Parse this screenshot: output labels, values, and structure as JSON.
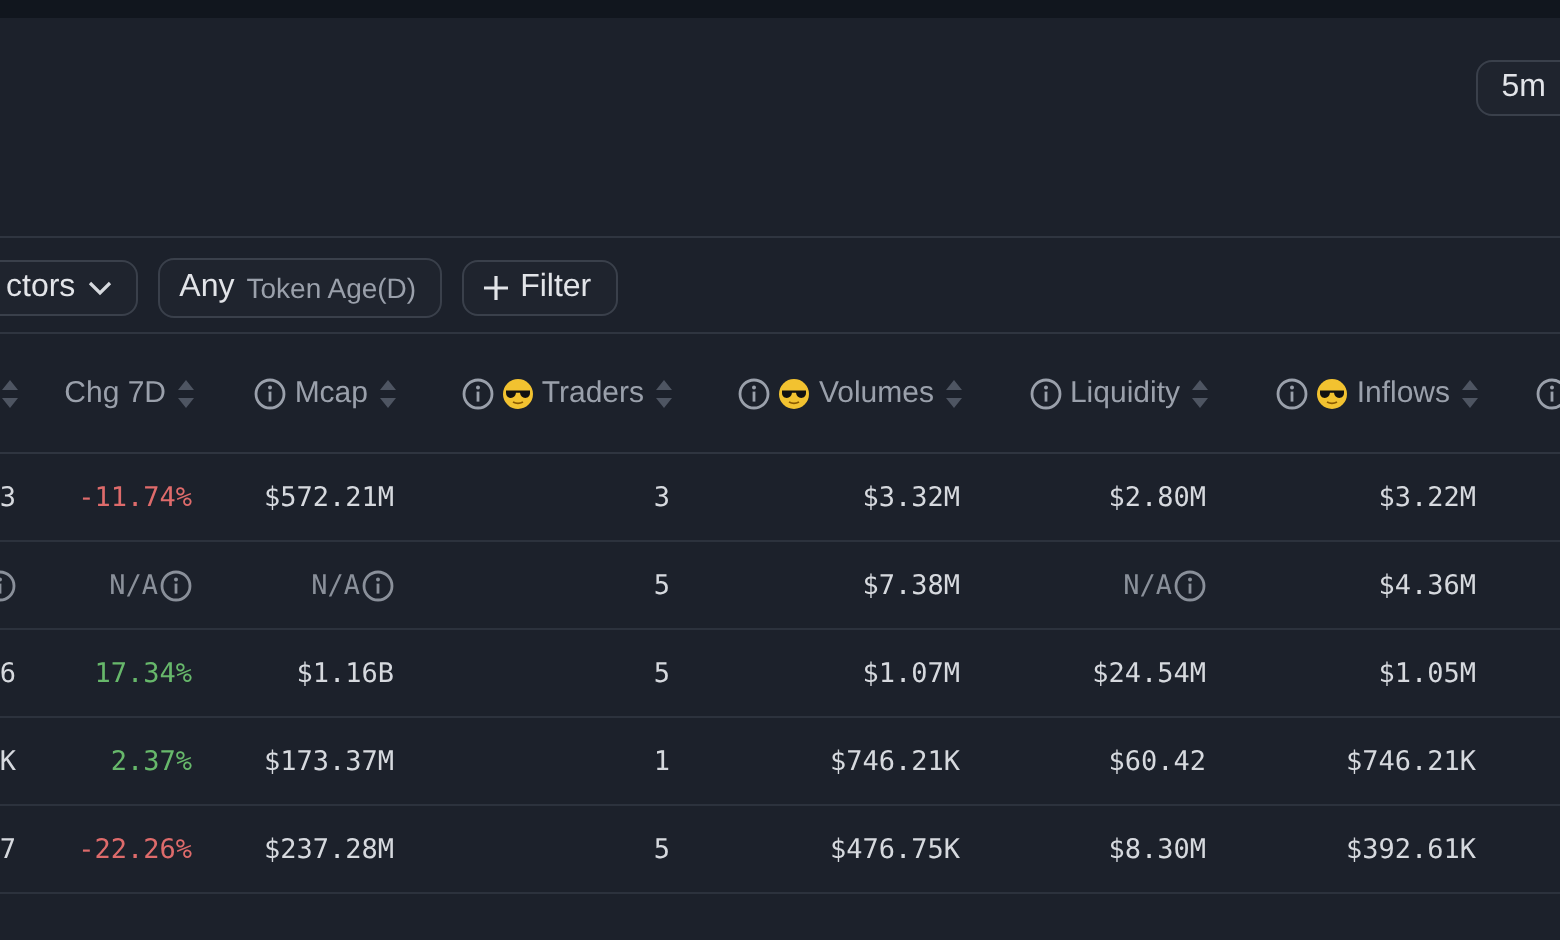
{
  "timeframe": {
    "label": "5m"
  },
  "filters": [
    {
      "kind": "dropdown",
      "label": "ctors"
    },
    {
      "kind": "range",
      "prefix": "Any",
      "label": "Token Age(D)"
    },
    {
      "kind": "add",
      "label": "Filter"
    }
  ],
  "table": {
    "columns": [
      {
        "sortable": true,
        "info": false,
        "emoji": false
      },
      {
        "label": "Chg 7D",
        "sortable": true,
        "info": false,
        "emoji": false
      },
      {
        "label": "Mcap",
        "sortable": true,
        "info": true,
        "emoji": false
      },
      {
        "label": "Traders",
        "sortable": true,
        "info": true,
        "emoji": true
      },
      {
        "label": "Volumes",
        "sortable": true,
        "info": true,
        "emoji": true
      },
      {
        "label": "Liquidity",
        "sortable": true,
        "info": true,
        "emoji": false
      },
      {
        "label": "Inflows",
        "sortable": true,
        "info": true,
        "emoji": true
      },
      {
        "sortable": false,
        "info": true,
        "emoji": false
      }
    ],
    "rows": [
      [
        {
          "kind": "plain",
          "text": "3"
        },
        {
          "kind": "down",
          "text": "-11.74%"
        },
        {
          "kind": "plain",
          "text": "$572.21M"
        },
        {
          "kind": "plain",
          "text": "3"
        },
        {
          "kind": "plain",
          "text": "$3.32M"
        },
        {
          "kind": "plain",
          "text": "$2.80M"
        },
        {
          "kind": "plain",
          "text": "$3.22M"
        }
      ],
      [
        {
          "kind": "na"
        },
        {
          "kind": "na",
          "text": "N/A"
        },
        {
          "kind": "na",
          "text": "N/A"
        },
        {
          "kind": "plain",
          "text": "5"
        },
        {
          "kind": "plain",
          "text": "$7.38M"
        },
        {
          "kind": "na",
          "text": "N/A"
        },
        {
          "kind": "plain",
          "text": "$4.36M"
        }
      ],
      [
        {
          "kind": "plain",
          "text": "6"
        },
        {
          "kind": "up",
          "text": "17.34%"
        },
        {
          "kind": "plain",
          "text": "$1.16B"
        },
        {
          "kind": "plain",
          "text": "5"
        },
        {
          "kind": "plain",
          "text": "$1.07M"
        },
        {
          "kind": "plain",
          "text": "$24.54M"
        },
        {
          "kind": "plain",
          "text": "$1.05M"
        }
      ],
      [
        {
          "kind": "plain",
          "text": "K"
        },
        {
          "kind": "up",
          "text": "2.37%"
        },
        {
          "kind": "plain",
          "text": "$173.37M"
        },
        {
          "kind": "plain",
          "text": "1"
        },
        {
          "kind": "plain",
          "text": "$746.21K"
        },
        {
          "kind": "plain",
          "text": "$60.42"
        },
        {
          "kind": "plain",
          "text": "$746.21K"
        }
      ],
      [
        {
          "kind": "plain",
          "text": "7"
        },
        {
          "kind": "down",
          "text": "-22.26%"
        },
        {
          "kind": "plain",
          "text": "$237.28M"
        },
        {
          "kind": "plain",
          "text": "5"
        },
        {
          "kind": "plain",
          "text": "$476.75K"
        },
        {
          "kind": "plain",
          "text": "$8.30M"
        },
        {
          "kind": "plain",
          "text": "$392.61K"
        }
      ]
    ]
  }
}
